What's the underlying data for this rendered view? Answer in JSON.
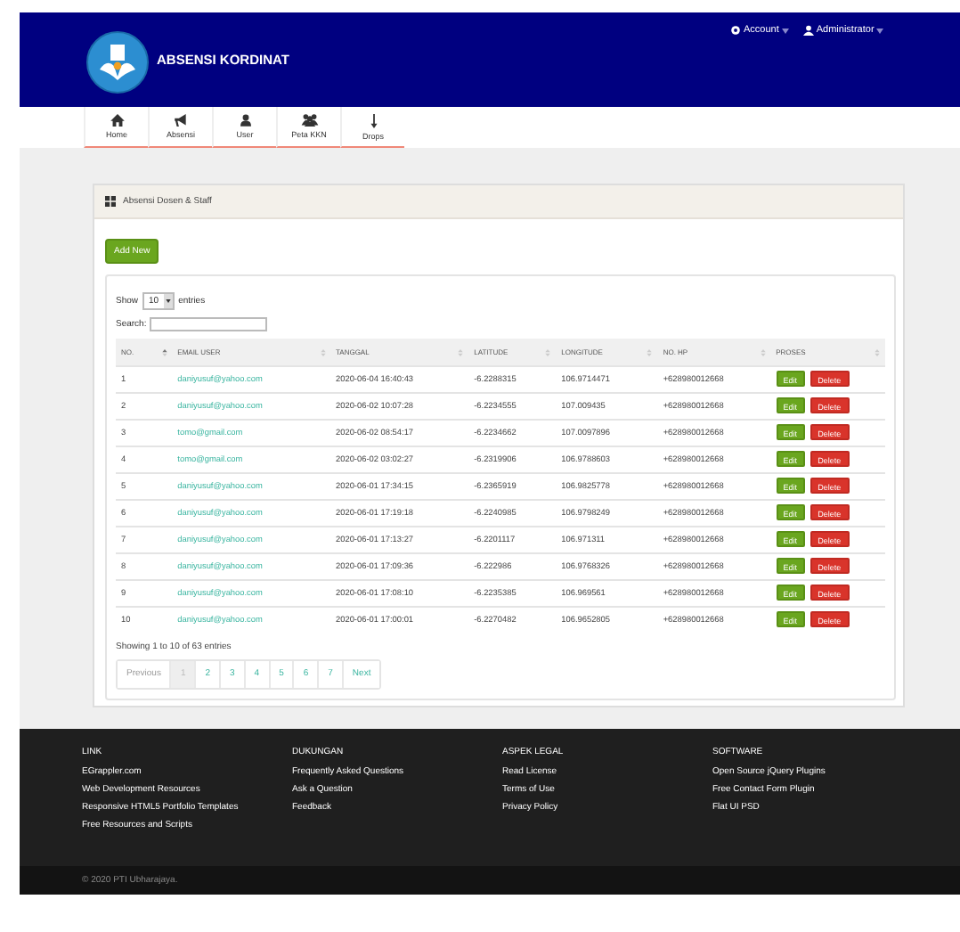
{
  "header": {
    "title": "ABSENSI KORDINAT",
    "menus": [
      {
        "label": "Account"
      },
      {
        "label": "Administrator"
      }
    ]
  },
  "nav": [
    {
      "label": "Home"
    },
    {
      "label": "Absensi"
    },
    {
      "label": "User"
    },
    {
      "label": "Peta KKN"
    },
    {
      "label": "Drops"
    }
  ],
  "panel": {
    "title": "Absensi Dosen & Staff",
    "add_button": "Add New",
    "length": {
      "prefix": "Show",
      "value": "10",
      "suffix": "entries"
    },
    "search_label": "Search:",
    "table": {
      "columns": [
        "NO.",
        "EMAIL USER",
        "TANGGAL",
        "LATITUDE",
        "LONGITUDE",
        "NO. HP",
        "PROSES"
      ],
      "rows": [
        {
          "cells": [
            "1",
            "daniyusuf@yahoo.com",
            "2020-06-04 16:40:43",
            "-6.2288315",
            "106.9714471",
            "+628980012668"
          ],
          "actions": [
            "Edit",
            "Delete"
          ]
        },
        {
          "cells": [
            "2",
            "daniyusuf@yahoo.com",
            "2020-06-02 10:07:28",
            "-6.2234555",
            "107.009435",
            "+628980012668"
          ],
          "actions": [
            "Edit",
            "Delete"
          ]
        },
        {
          "cells": [
            "3",
            "tomo@gmail.com",
            "2020-06-02 08:54:17",
            "-6.2234662",
            "107.0097896",
            "+628980012668"
          ],
          "actions": [
            "Edit",
            "Delete"
          ]
        },
        {
          "cells": [
            "4",
            "tomo@gmail.com",
            "2020-06-02 03:02:27",
            "-6.2319906",
            "106.9788603",
            "+628980012668"
          ],
          "actions": [
            "Edit",
            "Delete"
          ]
        },
        {
          "cells": [
            "5",
            "daniyusuf@yahoo.com",
            "2020-06-01 17:34:15",
            "-6.2365919",
            "106.9825778",
            "+628980012668"
          ],
          "actions": [
            "Edit",
            "Delete"
          ]
        },
        {
          "cells": [
            "6",
            "daniyusuf@yahoo.com",
            "2020-06-01 17:19:18",
            "-6.2240985",
            "106.9798249",
            "+628980012668"
          ],
          "actions": [
            "Edit",
            "Delete"
          ]
        },
        {
          "cells": [
            "7",
            "daniyusuf@yahoo.com",
            "2020-06-01 17:13:27",
            "-6.2201117",
            "106.971311",
            "+628980012668"
          ],
          "actions": [
            "Edit",
            "Delete"
          ]
        },
        {
          "cells": [
            "8",
            "daniyusuf@yahoo.com",
            "2020-06-01 17:09:36",
            "-6.222986",
            "106.9768326",
            "+628980012668"
          ],
          "actions": [
            "Edit",
            "Delete"
          ]
        },
        {
          "cells": [
            "9",
            "daniyusuf@yahoo.com",
            "2020-06-01 17:08:10",
            "-6.2235385",
            "106.969561",
            "+628980012668"
          ],
          "actions": [
            "Edit",
            "Delete"
          ]
        },
        {
          "cells": [
            "10",
            "daniyusuf@yahoo.com",
            "2020-06-01 17:00:01",
            "-6.2270482",
            "106.9652805",
            "+628980012668"
          ],
          "actions": [
            "Edit",
            "Delete"
          ]
        }
      ]
    },
    "info": "Showing 1 to 10 of 63 entries",
    "pagination": [
      {
        "label": "Previous",
        "selected": false,
        "disabled": true
      },
      {
        "label": "1",
        "selected": true,
        "disabled": false
      },
      {
        "label": "2",
        "selected": false,
        "disabled": false
      },
      {
        "label": "3",
        "selected": false,
        "disabled": false
      },
      {
        "label": "4",
        "selected": false,
        "disabled": false
      },
      {
        "label": "5",
        "selected": false,
        "disabled": false
      },
      {
        "label": "6",
        "selected": false,
        "disabled": false
      },
      {
        "label": "7",
        "selected": false,
        "disabled": false
      },
      {
        "label": "Next",
        "selected": false,
        "disabled": false
      }
    ]
  },
  "footer": {
    "columns": [
      {
        "heading": "LINK",
        "links": [
          "EGrappler.com",
          "Web Development Resources",
          "Responsive HTML5 Portfolio Templates",
          "Free Resources and Scripts"
        ]
      },
      {
        "heading": "DUKUNGAN",
        "links": [
          "Frequently Asked Questions",
          "Ask a Question",
          "Feedback"
        ]
      },
      {
        "heading": "ASPEK LEGAL",
        "links": [
          "Read License",
          "Terms of Use",
          "Privacy Policy"
        ]
      },
      {
        "heading": "SOFTWARE",
        "links": [
          "Open Source jQuery Plugins",
          "Free Contact Form Plugin",
          "Flat UI PSD"
        ]
      }
    ],
    "copyright": "© 2020 PTI Ubharajaya."
  }
}
